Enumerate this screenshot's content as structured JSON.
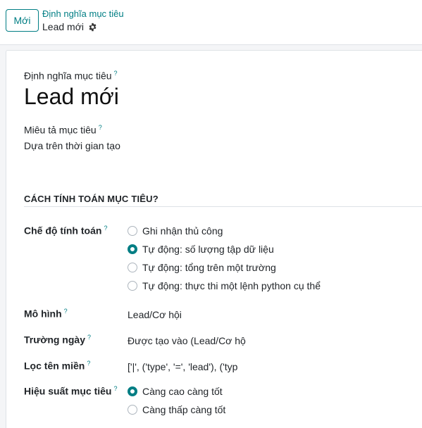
{
  "header": {
    "new_button": "Mới",
    "breadcrumb_parent": "Định nghĩa mục tiêu",
    "breadcrumb_current": "Lead mới"
  },
  "form": {
    "name_label": "Định nghĩa mục tiêu",
    "name_value": "Lead mới",
    "description_label": "Miêu tả mục tiêu",
    "description_value": "Dựa trên thời gian tạo",
    "section_title": "CÁCH TÍNH TOÁN MỤC TIÊU?",
    "mode_label": "Chế độ tính toán",
    "mode_options": [
      {
        "label": "Ghi nhận thủ công",
        "checked": false
      },
      {
        "label": "Tự động: số lượng tập dữ liệu",
        "checked": true
      },
      {
        "label": "Tự động: tổng trên một trường",
        "checked": false
      },
      {
        "label": "Tự động: thực thi một lệnh python cụ thể",
        "checked": false
      }
    ],
    "model_label": "Mô hình",
    "model_value": "Lead/Cơ hội",
    "date_field_label": "Trường ngày",
    "date_field_value": "Được tạo vào (Lead/Cơ hộ",
    "domain_label": "Lọc tên miền",
    "domain_value": "['|', ('type', '=', 'lead'), ('typ",
    "performance_label": "Hiệu suất mục tiêu",
    "performance_options": [
      {
        "label": "Càng cao càng tốt",
        "checked": true
      },
      {
        "label": "Càng thấp càng tốt",
        "checked": false
      }
    ],
    "help_mark": "?"
  },
  "colors": {
    "accent": "#017e84",
    "text": "#212529",
    "background": "#f4f5f7"
  }
}
